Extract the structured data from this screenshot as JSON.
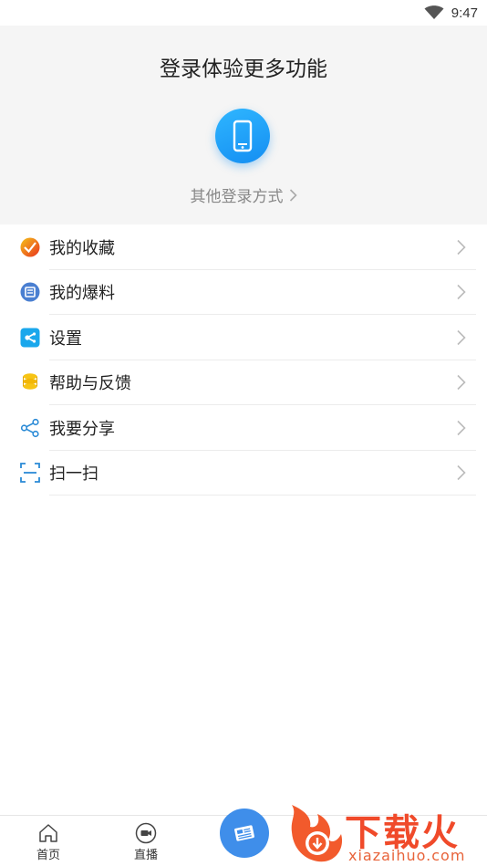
{
  "status_bar": {
    "time": "9:47",
    "wifi_icon": "wifi-icon"
  },
  "header": {
    "title": "登录体验更多功能",
    "phone_icon": "phone-icon",
    "other_login": "其他登录方式",
    "accent": "#1f9bf5"
  },
  "menu": {
    "items": [
      {
        "label": "我的收藏",
        "icon": "collection-icon"
      },
      {
        "label": "我的爆料",
        "icon": "news-tip-icon"
      },
      {
        "label": "设置",
        "icon": "settings-icon"
      },
      {
        "label": "帮助与反馈",
        "icon": "help-feedback-icon"
      },
      {
        "label": "我要分享",
        "icon": "share-icon"
      },
      {
        "label": "扫一扫",
        "icon": "scan-icon"
      }
    ]
  },
  "tabbar": {
    "tabs": [
      {
        "label": "首页",
        "icon": "home-icon"
      },
      {
        "label": "直播",
        "icon": "live-icon"
      }
    ],
    "center_icon": "newspaper-icon"
  },
  "watermark": {
    "text": "下载火",
    "url": "xiazaihuo.com"
  }
}
